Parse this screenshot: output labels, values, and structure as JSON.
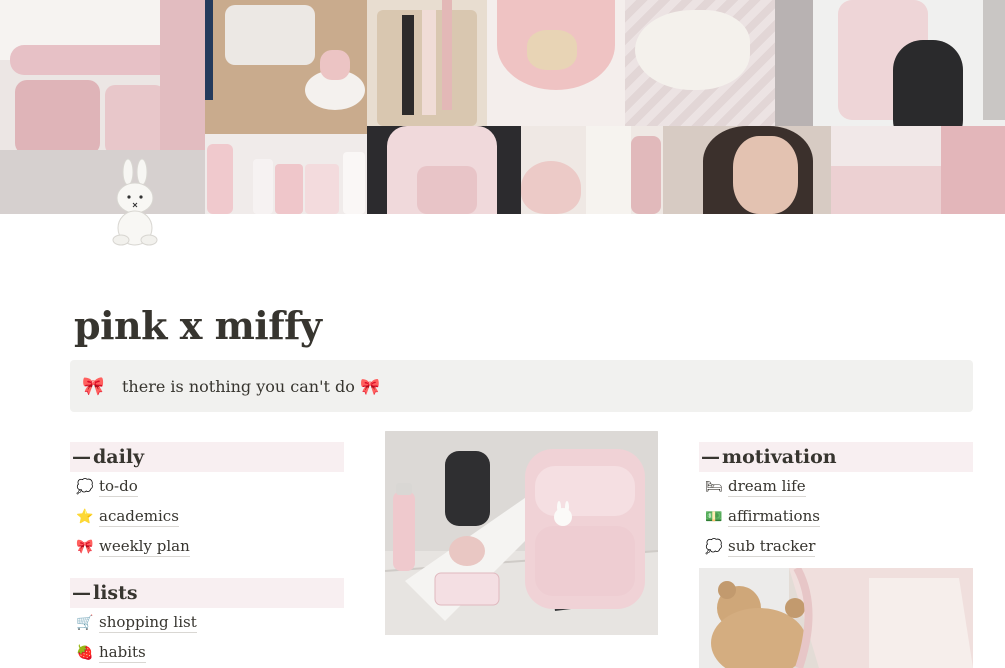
{
  "page": {
    "title": "pink x miffy",
    "callout": {
      "emoji": "🎀",
      "text": "there is nothing you can't do 🎀"
    }
  },
  "cover": {
    "colors": {
      "pink": "#e9c9cc",
      "blush": "#f3dedf",
      "cream": "#f2ece4",
      "wood": "#c9ad8e",
      "gray": "#bfbab6",
      "dark": "#2a2a2c"
    }
  },
  "columns": {
    "left": {
      "daily": {
        "heading": "daily",
        "items": [
          {
            "icon": "speech-bubble-icon",
            "glyph": "💭",
            "label": "to-do"
          },
          {
            "icon": "star-icon",
            "glyph": "⭐",
            "label": "academics"
          },
          {
            "icon": "ribbon-icon",
            "glyph": "🎀",
            "label": "weekly plan"
          }
        ]
      },
      "lists": {
        "heading": "lists",
        "items": [
          {
            "icon": "cart-icon",
            "glyph": "🛒",
            "label": "shopping list"
          },
          {
            "icon": "habit-icon",
            "glyph": "🍓",
            "label": "habits"
          }
        ]
      }
    },
    "right": {
      "motivation": {
        "heading": "motivation",
        "items": [
          {
            "icon": "bed-icon",
            "glyph": "🛏",
            "label": "dream life"
          },
          {
            "icon": "money-icon",
            "glyph": "💵",
            "label": "affirmations"
          },
          {
            "icon": "speech-bubble-icon",
            "glyph": "💭",
            "label": "sub tracker"
          }
        ]
      }
    }
  },
  "dash": "—"
}
